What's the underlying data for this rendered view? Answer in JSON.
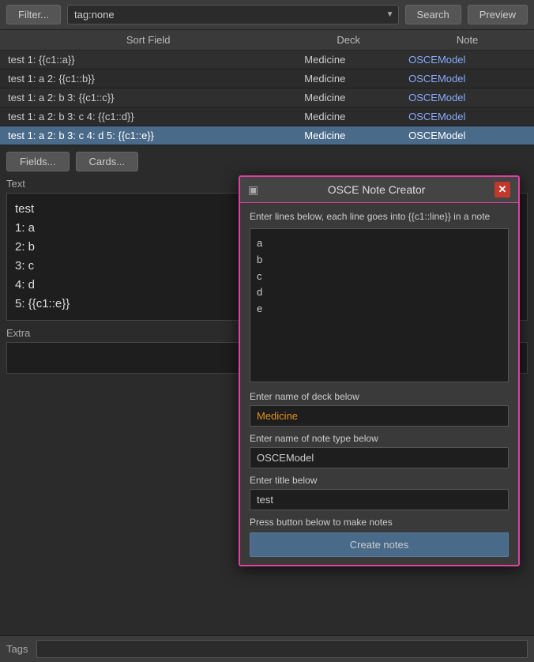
{
  "topbar": {
    "filter_label": "Filter...",
    "tag_value": "tag:none",
    "search_label": "Search",
    "preview_label": "Preview",
    "dropdown_arrow": "▼"
  },
  "table": {
    "columns": [
      "Sort Field",
      "Deck",
      "Note"
    ],
    "rows": [
      {
        "sort_field": "test 1: {{c1::a}}",
        "deck": "Medicine",
        "note": "OSCEModel",
        "selected": false
      },
      {
        "sort_field": "test 1: a 2: {{c1::b}}",
        "deck": "Medicine",
        "note": "OSCEModel",
        "selected": false
      },
      {
        "sort_field": "test 1: a 2: b 3: {{c1::c}}",
        "deck": "Medicine",
        "note": "OSCEModel",
        "selected": false
      },
      {
        "sort_field": "test 1: a 2: b 3: c 4: {{c1::d}}",
        "deck": "Medicine",
        "note": "OSCEModel",
        "selected": false
      },
      {
        "sort_field": "test 1: a 2: b 3: c 4: d 5: {{c1::e}}",
        "deck": "Medicine",
        "note": "OSCEModel",
        "selected": true
      }
    ]
  },
  "bottom": {
    "fields_label": "Fields...",
    "cards_label": "Cards...",
    "text_label": "Text",
    "text_content": "test\n1: a\n2: b\n3: c\n4: d\n5: {{c1::e}}",
    "extra_label": "Extra"
  },
  "tags": {
    "label": "Tags",
    "placeholder": ""
  },
  "modal": {
    "icon": "▣",
    "title": "OSCE Note Creator",
    "close": "✕",
    "instruction": "Enter lines below, each line goes into {{c1::line}} in a note",
    "textarea_content": "a\nb\nc\nd\ne",
    "deck_label": "Enter name of deck below",
    "deck_value": "Medicine",
    "note_type_label": "Enter name of note type below",
    "note_type_value": "OSCEModel",
    "title_label": "Enter title below",
    "title_value": "test",
    "press_label": "Press button below to make notes",
    "create_label": "Create notes"
  }
}
